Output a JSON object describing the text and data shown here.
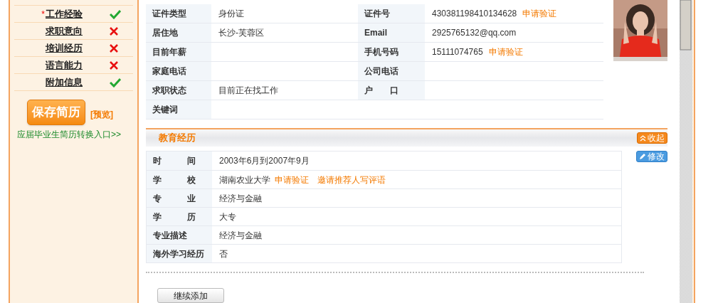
{
  "sidebar": {
    "items": [
      {
        "label": "工作经验",
        "required": true,
        "done": true
      },
      {
        "label": "求职意向",
        "required": false,
        "done": false
      },
      {
        "label": "培训经历",
        "required": false,
        "done": false
      },
      {
        "label": "语言能力",
        "required": false,
        "done": false
      },
      {
        "label": "附加信息",
        "required": false,
        "done": true
      }
    ],
    "required_mark": "*",
    "save_button": "保存简历",
    "preview_link": "[预览]",
    "graduate_link": "应届毕业生简历转换入口>>"
  },
  "profile": {
    "rows": [
      {
        "cells": [
          {
            "label": "证件类型",
            "value": "身份证"
          },
          {
            "label": "证件号",
            "value": "430381198410134628",
            "link": "申请验证"
          }
        ]
      },
      {
        "cells": [
          {
            "label": "居住地",
            "value": "长沙-芙蓉区"
          },
          {
            "label": "Email",
            "value": "2925765132@qq.com"
          }
        ]
      },
      {
        "cells": [
          {
            "label": "目前年薪"
          },
          {
            "label": "手机号码",
            "value": "15111074765",
            "link": "申请验证"
          }
        ]
      },
      {
        "cells": [
          {
            "label": "家庭电话"
          },
          {
            "label": "公司电话"
          }
        ]
      },
      {
        "cells": [
          {
            "label": "求职状态",
            "value": "目前正在找工作"
          },
          {
            "label": "户　　口"
          }
        ]
      },
      {
        "cells": [
          {
            "label": "关键词"
          }
        ]
      }
    ]
  },
  "education": {
    "title": "教育经历",
    "collapse_button": "收起",
    "edit_button": "修改",
    "rows": [
      {
        "label": "时　　　间",
        "value": "2003年6月到2007年9月"
      },
      {
        "label": "学　　　校",
        "value": "湖南农业大学",
        "links": [
          "申请验证",
          "邀请推荐人写评语"
        ]
      },
      {
        "label": "专　　　业",
        "value": "经济与金融"
      },
      {
        "label": "学　　　历",
        "value": "大专"
      },
      {
        "label": "专业描述",
        "value": "经济与金融"
      },
      {
        "label": "海外学习经历",
        "value": "否"
      }
    ],
    "add_button": "继续添加"
  }
}
